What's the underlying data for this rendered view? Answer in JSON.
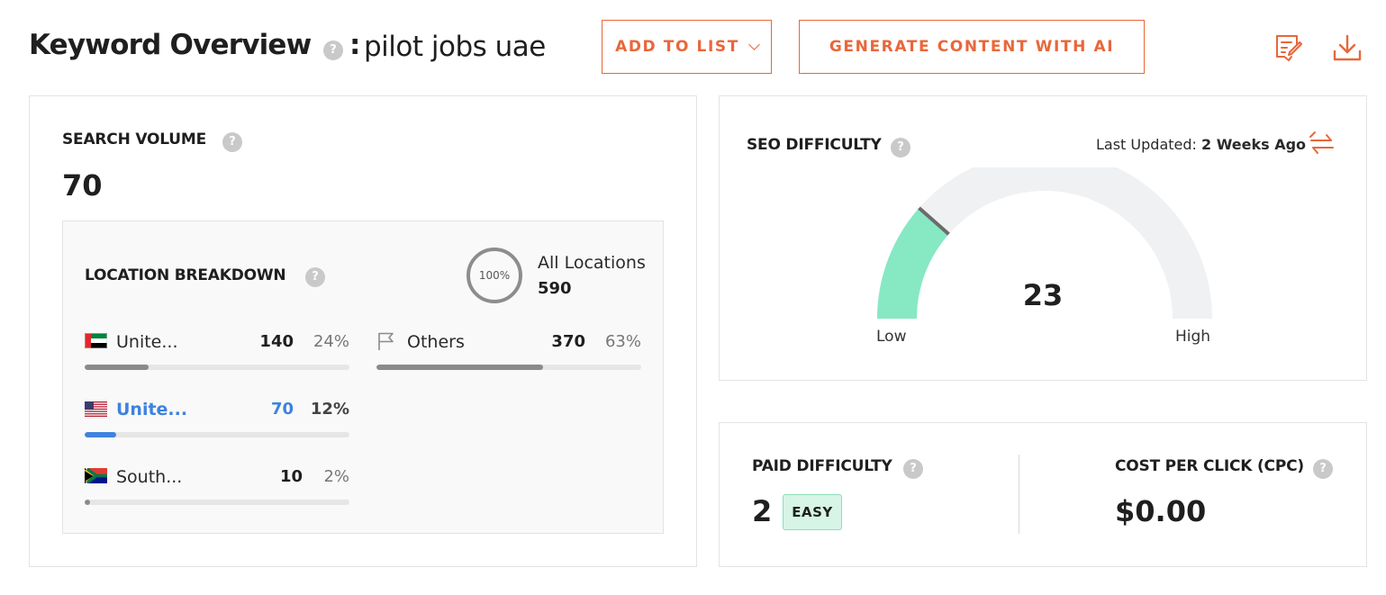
{
  "header": {
    "title": "Keyword Overview",
    "separator": ":",
    "keyword": "pilot jobs uae",
    "add_to_list_label": "ADD TO LIST",
    "generate_label": "GENERATE CONTENT WITH AI",
    "icons": [
      "edit-notes-icon",
      "download-icon"
    ],
    "accent_color": "#e8673a"
  },
  "search_volume": {
    "label": "SEARCH VOLUME",
    "value": "70",
    "location_breakdown": {
      "label": "LOCATION BREAKDOWN",
      "all_locations": {
        "ring_label": "100%",
        "label": "All Locations",
        "value": "590"
      },
      "rows": [
        {
          "flag": "uae-flag-icon",
          "name": "Unite...",
          "count": "140",
          "pct": "24%",
          "fraction": 0.24,
          "active": false
        },
        {
          "flag": "usa-flag-icon",
          "name": "Unite...",
          "count": "70",
          "pct": "12%",
          "fraction": 0.12,
          "active": true
        },
        {
          "flag": "south-africa-flag-icon",
          "name": "South...",
          "count": "10",
          "pct": "2%",
          "fraction": 0.02,
          "active": false
        },
        {
          "flag": "flag-outline-icon",
          "name": "Others",
          "count": "370",
          "pct": "63%",
          "fraction": 0.63,
          "active": false
        }
      ]
    }
  },
  "seo_difficulty": {
    "label": "SEO DIFFICULTY",
    "last_updated_label": "Last Updated:",
    "last_updated_value": "2 Weeks Ago",
    "value": "23",
    "fraction": 0.23,
    "low_label": "Low",
    "high_label": "High",
    "fill_color": "#86e9c4"
  },
  "paid_difficulty": {
    "label": "PAID DIFFICULTY",
    "value": "2",
    "badge": "EASY"
  },
  "cpc": {
    "label": "COST PER CLICK (CPC)",
    "value": "$0.00"
  }
}
